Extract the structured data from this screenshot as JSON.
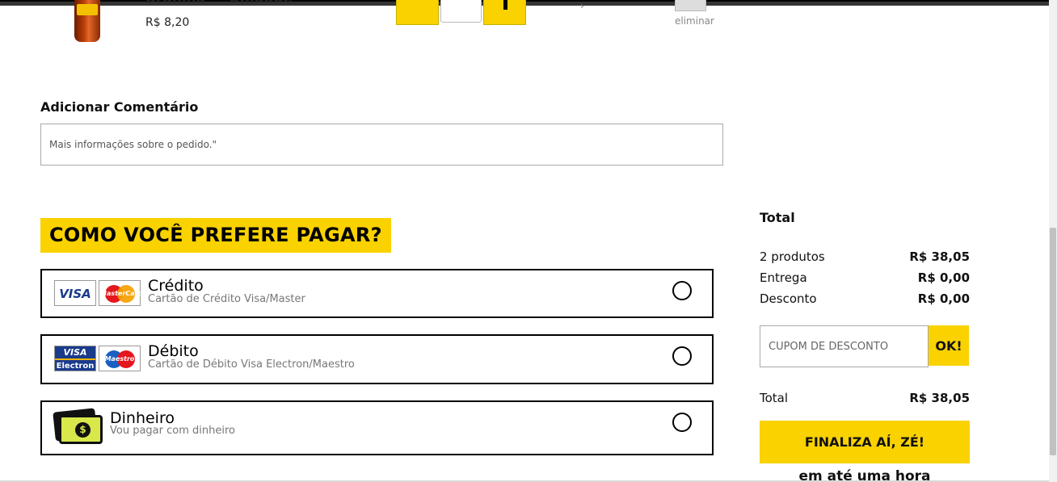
{
  "cart_item": {
    "name": "Brahma — Unidade",
    "price": "R$ 8,20",
    "quantity": "",
    "remove_label": "eliminar",
    "quantity_minus_icon": "minus-icon",
    "quantity_plus_icon": "plus-icon"
  },
  "comment": {
    "label": "Adicionar Comentário",
    "placeholder": "Mais informações sobre o pedido.\""
  },
  "payment": {
    "heading": "COMO VOCÊ PREFERE PAGAR?",
    "options": [
      {
        "title": "Crédito",
        "description": "Cartão de Crédito Visa/Master",
        "logos": {
          "visa": "VISA",
          "mastercard": "MasterCard"
        }
      },
      {
        "title": "Débito",
        "description": "Cartão de Débito Visa Electron/Maestro",
        "logos": {
          "visa_top": "VISA",
          "visa_bottom": "Electron",
          "maestro": "Maestro"
        }
      },
      {
        "title": "Dinheiro",
        "description": "Vou pagar com dinheiro",
        "logos": {
          "coin": "$"
        }
      }
    ]
  },
  "summary": {
    "title": "Total",
    "rows": [
      {
        "label": "2 produtos",
        "value": "R$ 38,05"
      },
      {
        "label": "Entrega",
        "value": "R$ 0,00"
      },
      {
        "label": "Desconto",
        "value": "R$ 0,00"
      }
    ],
    "coupon_placeholder": "CUPOM DE DESCONTO",
    "coupon_button": "OK!",
    "total_label": "Total",
    "total_value": "R$ 38,05",
    "finalize_button": "FINALIZA AÍ, ZÉ!",
    "delivery_note": "em até uma hora"
  },
  "colors": {
    "accent_yellow": "#f9d200",
    "border_black": "#000000",
    "muted_text": "#777777"
  }
}
